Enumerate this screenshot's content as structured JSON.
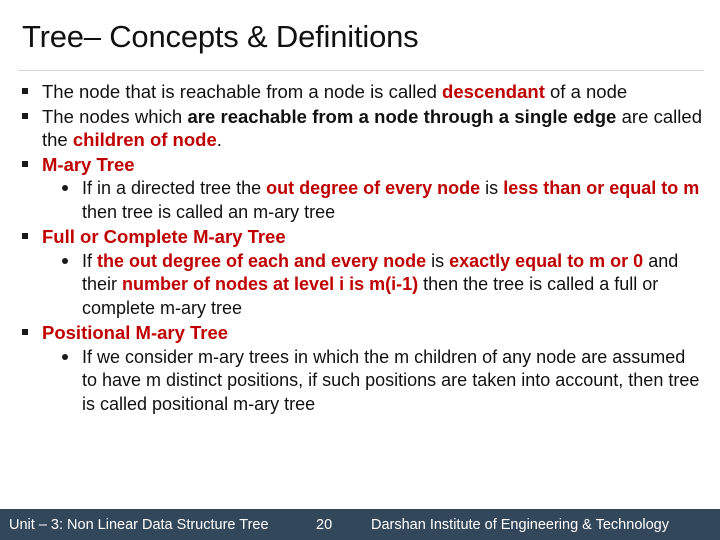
{
  "slide": {
    "title": "Tree– Concepts & Definitions",
    "bullets": [
      {
        "level": 1,
        "marker": "square-bullet",
        "justify": false,
        "runs": [
          {
            "text": "The node that is reachable from a node is called ",
            "style": "plain"
          },
          {
            "text": "descendant",
            "style": "red-bold"
          },
          {
            "text": " of a node",
            "style": "plain"
          }
        ]
      },
      {
        "level": 1,
        "marker": "square-bullet",
        "justify": true,
        "runs": [
          {
            "text": "The nodes which ",
            "style": "plain"
          },
          {
            "text": "are reachable from a node through a single edge",
            "style": "bold"
          },
          {
            "text": " are called the ",
            "style": "plain"
          },
          {
            "text": "children of node",
            "style": "red-bold"
          },
          {
            "text": ".",
            "style": "plain"
          }
        ]
      },
      {
        "level": 1,
        "marker": "square-bullet",
        "justify": false,
        "runs": [
          {
            "text": "M-ary Tree",
            "style": "red-bold"
          }
        ]
      },
      {
        "level": 2,
        "marker": "round-bullet",
        "justify": false,
        "runs": [
          {
            "text": "If in a directed tree the ",
            "style": "plain"
          },
          {
            "text": "out degree of every node",
            "style": "red-bold"
          },
          {
            "text": " is ",
            "style": "plain"
          },
          {
            "text": "less than or equal to m",
            "style": "red-bold"
          },
          {
            "text": " then tree is called an m-ary tree",
            "style": "plain"
          }
        ]
      },
      {
        "level": 1,
        "marker": "square-bullet",
        "justify": false,
        "runs": [
          {
            "text": "Full or Complete M-ary Tree",
            "style": "red-bold"
          }
        ]
      },
      {
        "level": 2,
        "marker": "round-bullet",
        "justify": false,
        "runs": [
          {
            "text": "If ",
            "style": "plain"
          },
          {
            "text": "the out degree of each and every node",
            "style": "red-bold"
          },
          {
            "text": " is ",
            "style": "plain"
          },
          {
            "text": "exactly equal to m or 0",
            "style": "red-bold"
          },
          {
            "text": " and their ",
            "style": "plain"
          },
          {
            "text": "number of nodes at level i is m(i-1)",
            "style": "red-bold"
          },
          {
            "text": " then the tree is called a full or complete m-ary tree",
            "style": "plain"
          }
        ]
      },
      {
        "level": 1,
        "marker": "square-bullet",
        "justify": false,
        "runs": [
          {
            "text": "Positional M-ary Tree",
            "style": "red-bold"
          }
        ]
      },
      {
        "level": 2,
        "marker": "round-bullet",
        "justify": false,
        "runs": [
          {
            "text": "If we consider m-ary trees in which the m children of any node are assumed to have m distinct positions, if such positions are taken into account, then tree is called positional m-ary tree",
            "style": "plain"
          }
        ]
      }
    ]
  },
  "footer": {
    "unit": "Unit – 3: Non Linear Data Structure  Tree",
    "page": "20",
    "organization": "Darshan Institute of Engineering & Technology",
    "background_color": "#33475b",
    "text_color": "#ffffff"
  },
  "theme": {
    "accent_red": "#C00000",
    "text_black": "#111111",
    "rule_gray": "#d5d5d5",
    "page_background": "#ffffff"
  }
}
